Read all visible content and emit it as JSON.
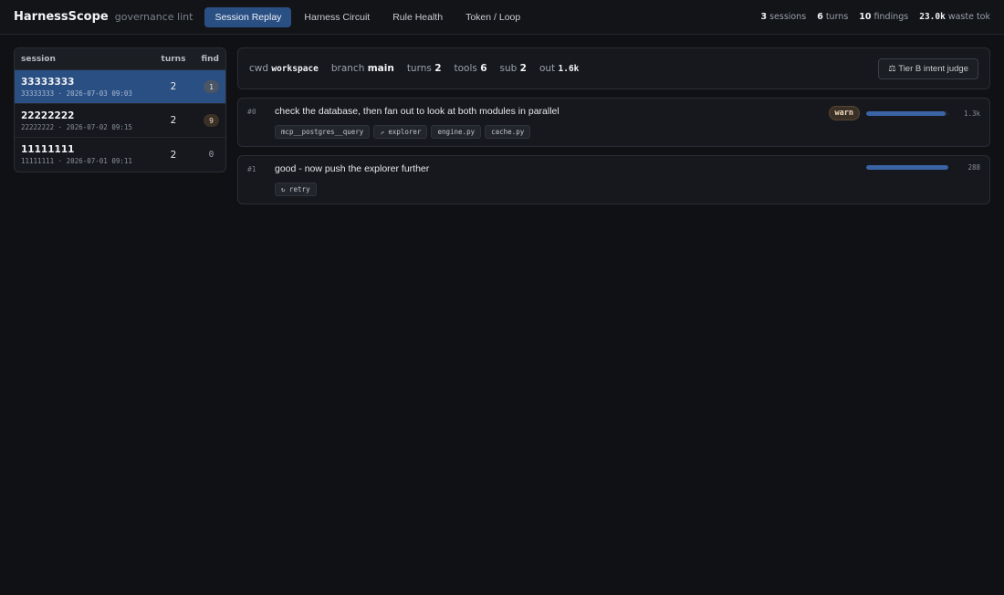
{
  "app": {
    "brand": "HarnessScope",
    "subtitle": "governance lint"
  },
  "nav": {
    "tabs": [
      {
        "label": "Session Replay",
        "active": true
      },
      {
        "label": "Harness Circuit",
        "active": false
      },
      {
        "label": "Rule Health",
        "active": false
      },
      {
        "label": "Token / Loop",
        "active": false
      }
    ]
  },
  "stats": {
    "sessions_value": "3",
    "sessions_label": "sessions",
    "turns_value": "6",
    "turns_label": "turns",
    "findings_value": "10",
    "findings_label": "findings",
    "waste_value": "23.0k",
    "waste_label": "waste tok"
  },
  "sessions": {
    "headers": {
      "session": "session",
      "turns": "turns",
      "find": "find"
    },
    "rows": [
      {
        "id": "33333333",
        "meta": "33333333 · 2026-07-03 09:03",
        "turns": "2",
        "find": "1",
        "active": true
      },
      {
        "id": "22222222",
        "meta": "22222222 · 2026-07-02 09:15",
        "turns": "2",
        "find": "9",
        "active": false
      },
      {
        "id": "11111111",
        "meta": "11111111 · 2026-07-01 09:11",
        "turns": "2",
        "find": "0",
        "active": false
      }
    ]
  },
  "info": {
    "cwd_label": "cwd",
    "cwd_value": "workspace",
    "branch_label": "branch",
    "branch_value": "main",
    "turns_label": "turns",
    "turns_value": "2",
    "tools_label": "tools",
    "tools_value": "6",
    "sub_label": "sub",
    "sub_value": "2",
    "out_label": "out",
    "out_value": "1.6k",
    "judge_button": "⚖ Tier B intent judge"
  },
  "turns": [
    {
      "index": "#0",
      "text": "check the database, then fan out to look at both modules in parallel",
      "tags": [
        "mcp__postgres__query",
        "⇗ explorer",
        "engine.py",
        "cache.py"
      ],
      "severity": "warn",
      "tokens": "1.3k",
      "token_fraction": 0.97
    },
    {
      "index": "#1",
      "text": "good - now push the explorer further",
      "tags": [
        "↻ retry"
      ],
      "severity": "",
      "tokens": "288",
      "token_fraction": 1.0
    }
  ],
  "colors": {
    "accent": "#2a4f82",
    "bar": "#3a64a6",
    "warn_bg": "#3a3026"
  }
}
